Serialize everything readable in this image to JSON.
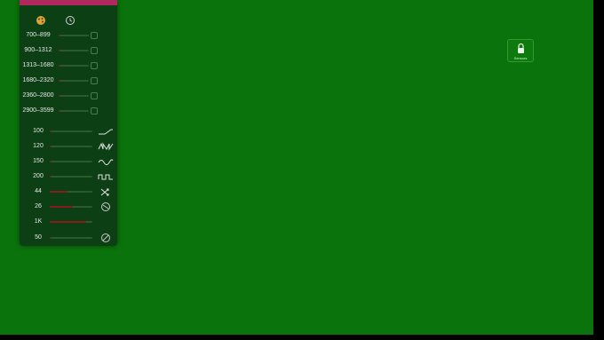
{
  "toolbar": {
    "left_icon": "palette-icon",
    "right_icon": "clock-icon"
  },
  "frequency_ranges": [
    {
      "label": "700–899",
      "level": 0.05
    },
    {
      "label": "900–1312",
      "level": 0.05
    },
    {
      "label": "1313–1680",
      "level": 0.05
    },
    {
      "label": "1680–2320",
      "level": 0.05
    },
    {
      "label": "2360–2800",
      "level": 0.05
    },
    {
      "label": "2900–3599",
      "level": 0.05
    }
  ],
  "params": [
    {
      "label": "100",
      "level": 0.05,
      "icon": "sawtooth-wave-icon"
    },
    {
      "label": "120",
      "level": 0.05,
      "icon": "triangle-pulse-wave-icon"
    },
    {
      "label": "150",
      "level": 0.05,
      "icon": "sine-wave-icon"
    },
    {
      "label": "200",
      "level": 0.05,
      "icon": "square-wave-icon"
    },
    {
      "label": "44",
      "level": 0.42,
      "icon": "shuffle-icon"
    },
    {
      "label": "26",
      "level": 0.55,
      "icon": "no-entry-icon"
    },
    {
      "label": "1K",
      "level": 0.85,
      "icon": ""
    },
    {
      "label": "50",
      "level": 0.05,
      "icon": "block-icon"
    }
  ],
  "lock": {
    "label": "Sensors",
    "icon": "lock-icon"
  },
  "colors": {
    "background": "#0b730b",
    "panel": "#0d3f15",
    "accent_bar": "#b0285e",
    "slider_fill": "#8b1a1a"
  }
}
